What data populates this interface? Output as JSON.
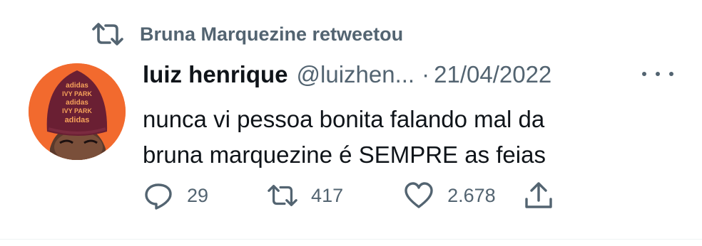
{
  "retweet_context": {
    "icon": "retweet-icon",
    "text": "Bruna Marquezine retweetou"
  },
  "tweet": {
    "avatar_text": "adidas IVY PARK adidas IVY PARK adidas",
    "author_name": "luiz henrique",
    "handle": "@luizhen...",
    "separator": "·",
    "date": "21/04/2022",
    "text_line1": "nunca vi pessoa bonita falando mal da",
    "text_line2": "bruna marquezine é SEMPRE as feias"
  },
  "actions": {
    "reply_count": "29",
    "retweet_count": "417",
    "like_count": "2.678",
    "icons": [
      "reply-icon",
      "retweet-icon",
      "like-icon",
      "share-icon"
    ]
  },
  "colors": {
    "secondary_text": "#536471",
    "primary_text": "#0f1419",
    "avatar_bg": "#f26a2e",
    "beanie": "#6a1f33"
  }
}
